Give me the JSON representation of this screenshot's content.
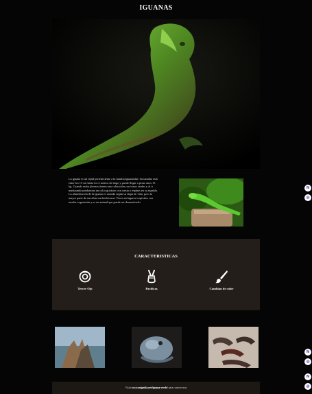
{
  "header": {
    "title": "IGUANAS"
  },
  "intro": {
    "paragraph": "La iguana es un reptil perteneciente a la familia Iguanaidae. Su tamaño está entre los 15 cm hasta los 2 metros de largo y puede llegar a pesar unos 15 kg. Cuando están jóvenes tienen una coloración con tonos verdes y al ir madurando predomina un color grisáceo con cresta o espinas en su espalda. La alimentación de la iguana es variada según su etapa de vida, pero la mayor parte de sus alim son herbívoras. Viven en lugares tropicales con mucha vegetación y es un animal que puede ser domesticado."
  },
  "features": {
    "title": "CARACTERISTICAS",
    "items": [
      {
        "label": "Tercer Ojo",
        "icon": "eye-icon"
      },
      {
        "label": "Pacificas",
        "icon": "peace-hand-icon"
      },
      {
        "label": "Cambian de color",
        "icon": "paintbrush-icon"
      }
    ]
  },
  "footer": {
    "prefix": "Visita",
    "link": "www.enjpedia.net/iguana-verde/",
    "suffix": "para conocer mas"
  },
  "colors": {
    "background": "#050505",
    "panel": "#231e19",
    "accent": "#6a3dbd"
  }
}
